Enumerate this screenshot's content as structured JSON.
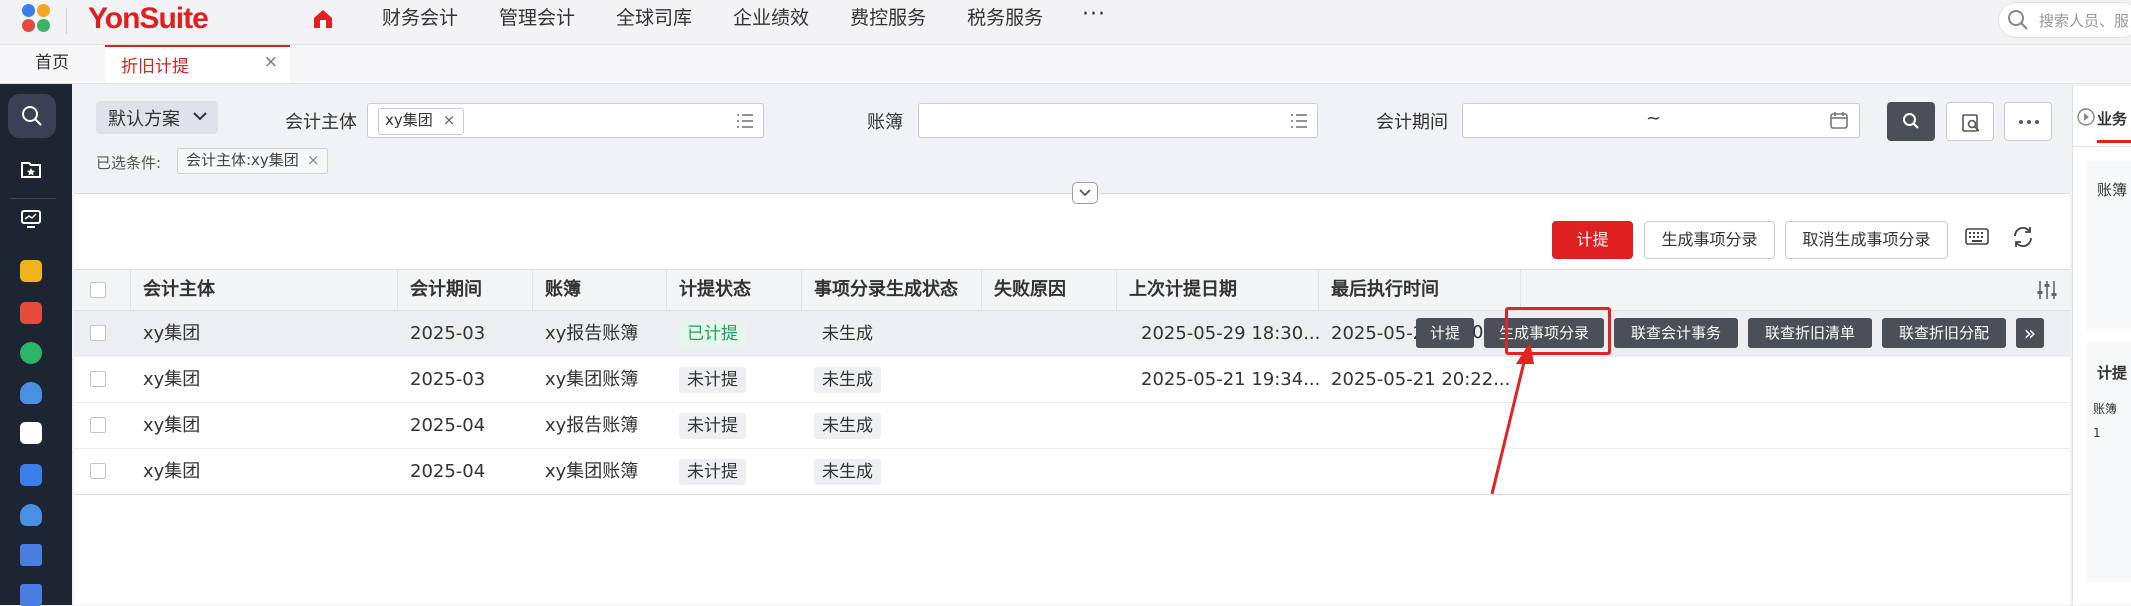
{
  "brand": {
    "name": "YonSuite"
  },
  "top_nav": {
    "items": [
      "财务会计",
      "管理会计",
      "全球司库",
      "企业绩效",
      "费控服务",
      "税务服务"
    ],
    "more": "···",
    "search_placeholder": "搜索人员、服"
  },
  "tabs": {
    "home": "首页",
    "active": "折旧计提",
    "close": "×"
  },
  "filter": {
    "scheme": "默认方案",
    "entity_label": "会计主体",
    "entity_chip": "xy集团",
    "chip_close": "×",
    "book_label": "账簿",
    "period_label": "会计期间",
    "period_tilde": "~",
    "selected_label": "已选条件:",
    "selected_chip": "会计主体:xy集团"
  },
  "toolbar": {
    "accrue": "计提",
    "generate_entry": "生成事项分录",
    "cancel_entry": "取消生成事项分录"
  },
  "table": {
    "columns": [
      "会计主体",
      "会计期间",
      "账簿",
      "计提状态",
      "事项分录生成状态",
      "失败原因",
      "上次计提日期",
      "最后执行时间"
    ],
    "rows": [
      {
        "entity": "xy集团",
        "period": "2025-03",
        "book": "xy报告账簿",
        "status": "已计提",
        "entry_status": "未生成",
        "fail": "",
        "last_date": "2025-05-29 18:30...",
        "exec_time": "2025-05-2"
      },
      {
        "entity": "xy集团",
        "period": "2025-03",
        "book": "xy集团账簿",
        "status": "未计提",
        "entry_status": "未生成",
        "fail": "",
        "last_date": "2025-05-21 19:34...",
        "exec_time": "2025-05-21 20:22..."
      },
      {
        "entity": "xy集团",
        "period": "2025-04",
        "book": "xy报告账簿",
        "status": "未计提",
        "entry_status": "未生成",
        "fail": "",
        "last_date": "",
        "exec_time": ""
      },
      {
        "entity": "xy集团",
        "period": "2025-04",
        "book": "xy集团账簿",
        "status": "未计提",
        "entry_status": "未生成",
        "fail": "",
        "last_date": "",
        "exec_time": ""
      }
    ],
    "row_actions": [
      "计提",
      "生成事项分录",
      "联查会计事务",
      "联查折旧清单",
      "联查折旧分配"
    ],
    "row_actions_more": "»",
    "exec_time_tail": "0"
  },
  "right_panel": {
    "title": "业务",
    "label1": "账簿",
    "label2": "计提",
    "label3": "账簿",
    "label4": "1"
  },
  "colors": {
    "brand_red": "#e02020",
    "rail": "#1d2532",
    "status_green": "#1aa35a"
  }
}
